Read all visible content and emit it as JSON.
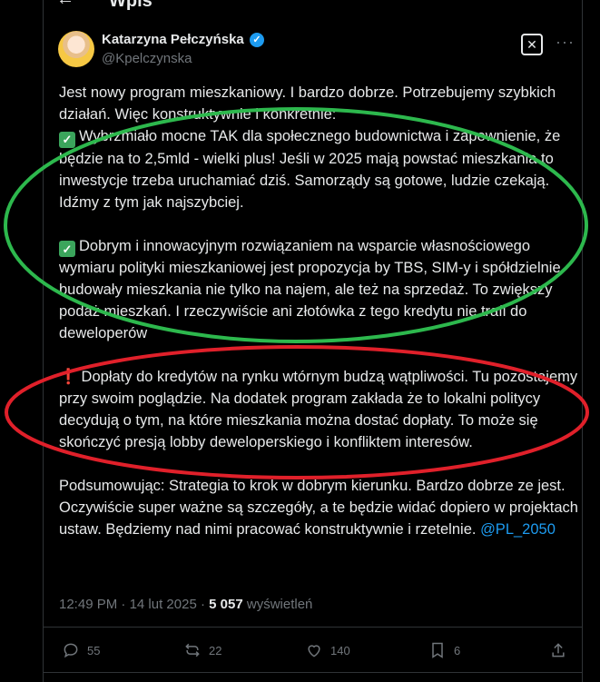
{
  "header": {
    "title": "Wpis"
  },
  "author": {
    "name": "Katarzyna Pełczyńska",
    "handle": "@Kpelczynska"
  },
  "tweet": {
    "p1_line": "Jest nowy program mieszkaniowy. I bardzo dobrze. Potrzebujemy szybkich działań. Więc konstruktywnie i konkretnie:",
    "p1_item": "Wybrzmiało mocne TAK dla społecznego budownictwa i zapewnienie, że będzie na to 2,5mld - wielki plus! Jeśli w 2025 mają powstać mieszkania to inwestycje trzeba uruchamiać dziś. Samorządy są gotowe, ludzie czekają. Idźmy z tym jak najszybciej.",
    "p2": "Dobrym i innowacyjnym rozwiązaniem na wsparcie własnościowego wymiaru polityki mieszkaniowej jest propozycja by TBS, SIM-y i spółdzielnie budowały mieszkania nie tylko na najem, ale też na sprzedaż. To zwiększy podaż mieszkań. I rzeczywiście ani złotówka z tego kredytu nie trafi do deweloperów",
    "p3": "Dopłaty do kredytów na rynku wtórnym budzą wątpliwości.  Tu pozostajemy przy swoim poglądzie. Na dodatek program zakłada że to lokalni politycy decydują o tym, na które mieszkania można dostać dopłaty. To może się skończyć presją lobby deweloperskiego i konfliktem interesów.",
    "p4": "Podsumowując: Strategia to krok w dobrym kierunku. Bardzo dobrze ze jest. Oczywiście super ważne są szczegóły, a te będzie widać dopiero w projektach ustaw. Będziemy nad nimi pracować konstruktywnie i rzetelnie.",
    "mention": "@PL_2050"
  },
  "meta": {
    "time": "12:49 PM",
    "sep": "·",
    "date": "14 lut 2025",
    "views": "5 057",
    "views_label": "wyświetleń"
  },
  "actions": {
    "replies": "55",
    "reposts": "22",
    "likes": "140",
    "bookmarks": "6"
  },
  "annotations": {
    "green_ellipse_color": "#2db84d",
    "red_ellipse_color": "#e0202a"
  },
  "icons": [
    "back-arrow-icon",
    "verified-badge-icon",
    "grok-icon",
    "more-icon",
    "check-mark-icon",
    "exclamation-icon",
    "reply-icon",
    "repost-icon",
    "like-icon",
    "bookmark-icon",
    "share-icon"
  ]
}
